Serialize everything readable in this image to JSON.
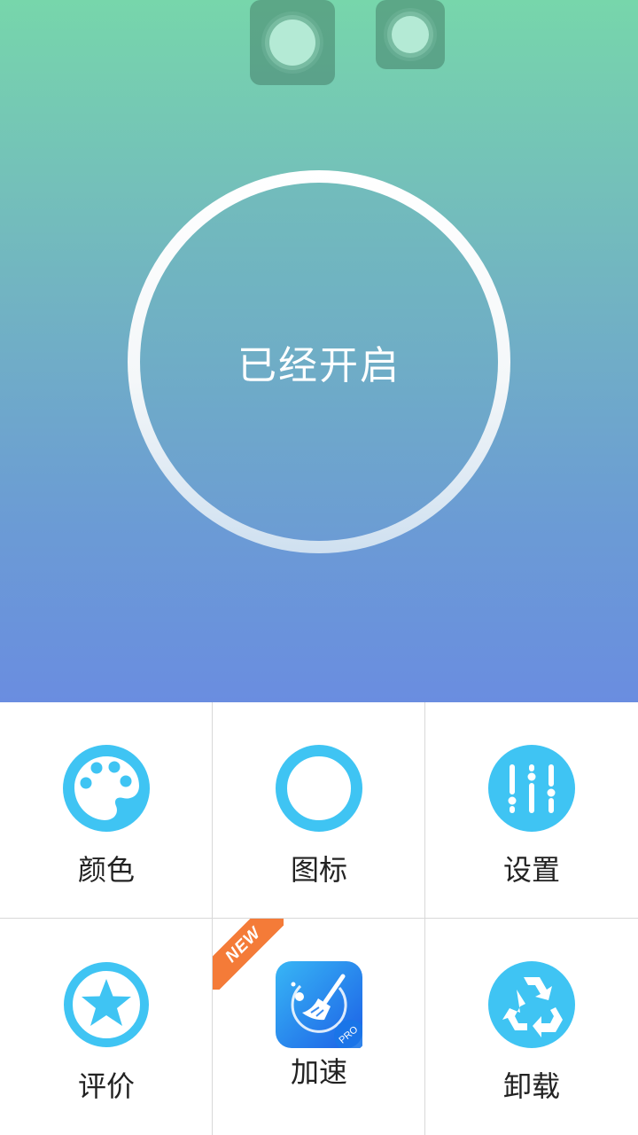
{
  "hero": {
    "status_text": "已经开启"
  },
  "menu": {
    "items": [
      {
        "label": "颜色",
        "icon": "palette-icon"
      },
      {
        "label": "图标",
        "icon": "ring-icon"
      },
      {
        "label": "设置",
        "icon": "sliders-icon"
      },
      {
        "label": "评价",
        "icon": "star-icon"
      },
      {
        "label": "加速",
        "icon": "broom-icon",
        "badge": "NEW",
        "badge_sub": "PRO"
      },
      {
        "label": "卸载",
        "icon": "recycle-icon"
      }
    ]
  },
  "colors": {
    "accent": "#3fc4f3",
    "ribbon": "#f47b38",
    "hero_top": "#77d6ab",
    "hero_bottom": "#6a8de0"
  }
}
